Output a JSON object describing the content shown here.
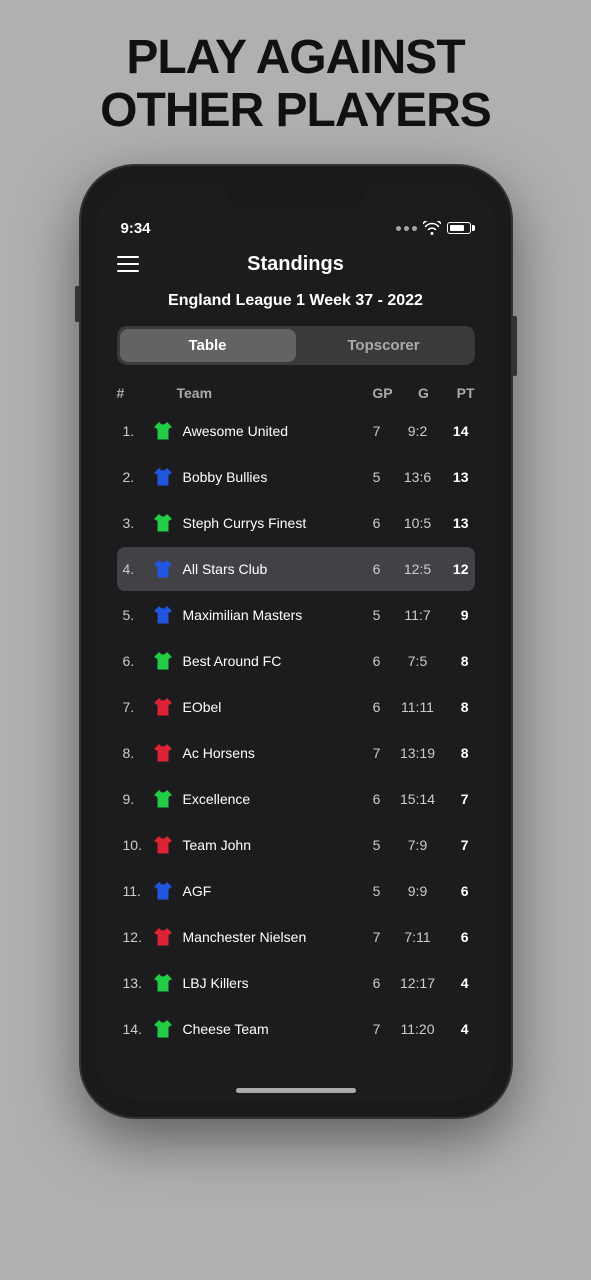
{
  "headline": {
    "line1": "PLAY AGAINST",
    "line2": "OTHER PLAYERS"
  },
  "phone": {
    "status_bar": {
      "time": "9:34",
      "signal_dots": 3
    },
    "app": {
      "title": "Standings",
      "league_title": "England League 1 Week 37 - 2022",
      "tabs": [
        {
          "label": "Table",
          "active": true
        },
        {
          "label": "Topscorer",
          "active": false
        }
      ],
      "table_headers": {
        "rank": "#",
        "team": "Team",
        "gp": "GP",
        "g": "G",
        "pt": "PT"
      },
      "teams": [
        {
          "rank": "1.",
          "name": "Awesome United",
          "jersey_color": "green",
          "gp": "7",
          "g": "9:2",
          "pt": "14",
          "highlighted": false
        },
        {
          "rank": "2.",
          "name": "Bobby Bullies",
          "jersey_color": "blue",
          "gp": "5",
          "g": "13:6",
          "pt": "13",
          "highlighted": false
        },
        {
          "rank": "3.",
          "name": "Steph Currys Finest",
          "jersey_color": "green",
          "gp": "6",
          "g": "10:5",
          "pt": "13",
          "highlighted": false
        },
        {
          "rank": "4.",
          "name": "All Stars Club",
          "jersey_color": "blue",
          "gp": "6",
          "g": "12:5",
          "pt": "12",
          "highlighted": true
        },
        {
          "rank": "5.",
          "name": "Maximilian Masters",
          "jersey_color": "blue",
          "gp": "5",
          "g": "11:7",
          "pt": "9",
          "highlighted": false
        },
        {
          "rank": "6.",
          "name": "Best Around FC",
          "jersey_color": "green",
          "gp": "6",
          "g": "7:5",
          "pt": "8",
          "highlighted": false
        },
        {
          "rank": "7.",
          "name": "EObel",
          "jersey_color": "red",
          "gp": "6",
          "g": "11:11",
          "pt": "8",
          "highlighted": false
        },
        {
          "rank": "8.",
          "name": "Ac Horsens",
          "jersey_color": "red",
          "gp": "7",
          "g": "13:19",
          "pt": "8",
          "highlighted": false
        },
        {
          "rank": "9.",
          "name": "Excellence",
          "jersey_color": "green",
          "gp": "6",
          "g": "15:14",
          "pt": "7",
          "highlighted": false
        },
        {
          "rank": "10.",
          "name": "Team John",
          "jersey_color": "red",
          "gp": "5",
          "g": "7:9",
          "pt": "7",
          "highlighted": false
        },
        {
          "rank": "11.",
          "name": "AGF",
          "jersey_color": "blue",
          "gp": "5",
          "g": "9:9",
          "pt": "6",
          "highlighted": false
        },
        {
          "rank": "12.",
          "name": "Manchester Nielsen",
          "jersey_color": "red",
          "gp": "7",
          "g": "7:11",
          "pt": "6",
          "highlighted": false
        },
        {
          "rank": "13.",
          "name": "LBJ Killers",
          "jersey_color": "green",
          "gp": "6",
          "g": "12:17",
          "pt": "4",
          "highlighted": false
        },
        {
          "rank": "14.",
          "name": "Cheese Team",
          "jersey_color": "green",
          "gp": "7",
          "g": "11:20",
          "pt": "4",
          "highlighted": false
        }
      ]
    }
  },
  "jersey_colors": {
    "green": "#22cc44",
    "blue": "#2255dd",
    "red": "#dd2233"
  }
}
